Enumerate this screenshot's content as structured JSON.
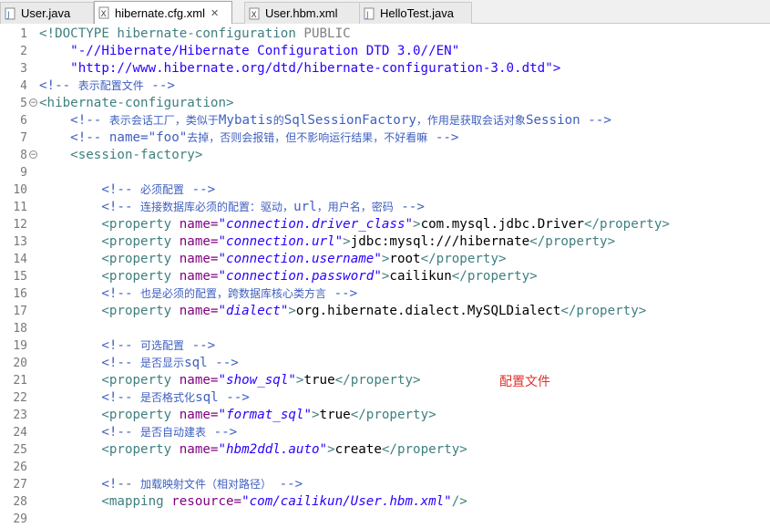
{
  "tabs": [
    {
      "label": "User.java",
      "icon": "java-file-icon"
    },
    {
      "label": "hibernate.cfg.xml",
      "icon": "xml-file-icon",
      "active": true
    },
    {
      "label": "User.hbm.xml",
      "icon": "xml-file-icon"
    },
    {
      "label": "HelloTest.java",
      "icon": "java-file-icon"
    }
  ],
  "close_symbol": "✕",
  "line_numbers": [
    "1",
    "2",
    "3",
    "4",
    "5",
    "6",
    "7",
    "8",
    "9",
    "10",
    "11",
    "12",
    "13",
    "14",
    "15",
    "16",
    "17",
    "18",
    "19",
    "20",
    "21",
    "22",
    "23",
    "24",
    "25",
    "26",
    "27",
    "28",
    "29"
  ],
  "code": {
    "l1a": "<!DOCTYPE hibernate-configuration ",
    "l1b": "PUBLIC",
    "l2": "    \"-//Hibernate/Hibernate Configuration DTD 3.0//EN\"",
    "l3": "    \"http://www.hibernate.org/dtd/hibernate-configuration-3.0.dtd\">",
    "l4a": "<!-- ",
    "l4b": "表示配置文件",
    "l4c": " -->",
    "l5": "<hibernate-configuration>",
    "l6a": "    <!-- ",
    "l6b": "表示会话工厂，类似于",
    "l6c": "Mybatis",
    "l6d": "的",
    "l6e": "SqlSessionFactory",
    "l6f": "，作用是获取会话对象",
    "l6g": "Session -->",
    "l7a": "    <!-- name=\"foo\"",
    "l7b": "去掉，否则会报错，但不影响运行结果，不好看嘛",
    "l7c": " -->",
    "l8": "    <session-factory>",
    "l10a": "        <!-- ",
    "l10b": "必须配置",
    "l10c": " -->",
    "l11a": "        <!-- ",
    "l11b": "连接数据库必须的配置：驱动，",
    "l11c": "url",
    "l11d": "，用户名，密码",
    "l11e": " -->",
    "p_open": "<property ",
    "p_name": "name=",
    "p_close": "</property>",
    "indent": "        ",
    "l12v": "\"connection.driver_class\"",
    "l12t": "com.mysql.jdbc.Driver",
    "l13v": "\"connection.url\"",
    "l13t": "jdbc:mysql:///hibernate",
    "l14v": "\"connection.username\"",
    "l14t": "root",
    "l15v": "\"connection.password\"",
    "l15t": "cailikun",
    "l16a": "        <!-- ",
    "l16b": "也是必须的配置，跨数据库核心类方言",
    "l16c": " -->",
    "l17v": "\"dialect\"",
    "l17t": "org.hibernate.dialect.MySQLDialect",
    "l19a": "        <!-- ",
    "l19b": "可选配置",
    "l19c": " -->",
    "l20a": "        <!-- ",
    "l20b": "是否显示",
    "l20c": "sql -->",
    "l21v": "\"show_sql\"",
    "l21t": "true",
    "l22a": "        <!-- ",
    "l22b": "是否格式化",
    "l22c": "sql -->",
    "l23v": "\"format_sql\"",
    "l23t": "true",
    "l24a": "        <!-- ",
    "l24b": "是否自动建表",
    "l24c": " -->",
    "l25v": "\"hbm2ddl.auto\"",
    "l25t": "create",
    "l27a": "        <!-- ",
    "l27b": "加载映射文件（相对路径）",
    "l27c": " -->",
    "l28a": "        <mapping ",
    "l28b": "resource=",
    "l28c": "\"com/cailikun/User.hbm.xml\"",
    "l28d": "/>"
  },
  "annotation": "配置文件",
  "colors": {
    "comment": "#3f5fbf",
    "tag": "#3f7f7f",
    "attr": "#7f007f",
    "value": "#2a00ff",
    "annotation": "#e0302b"
  }
}
